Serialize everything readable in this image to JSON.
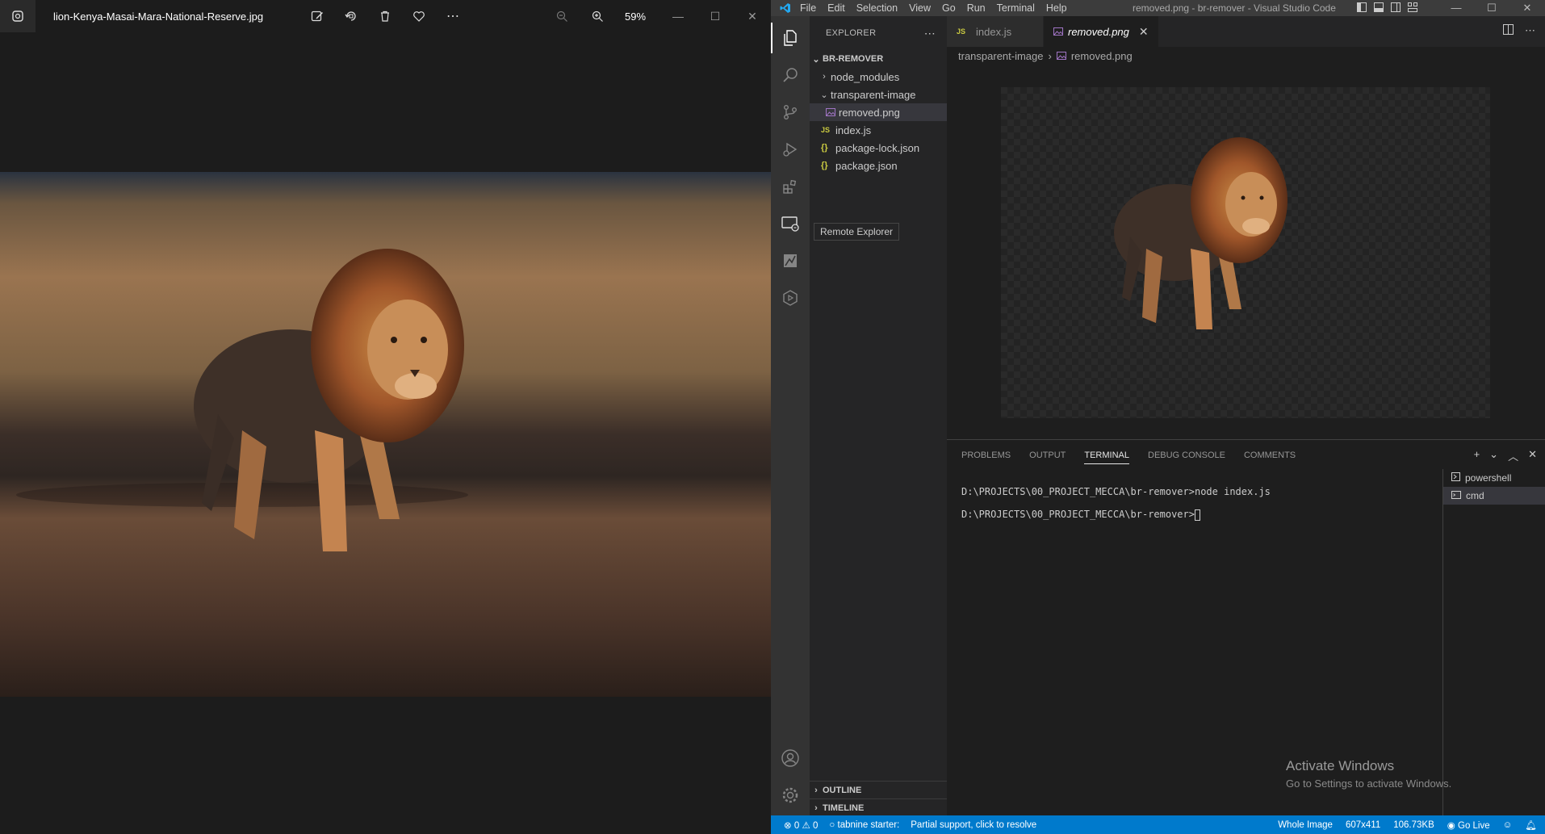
{
  "photos": {
    "filename": "lion-Kenya-Masai-Mara-National-Reserve.jpg",
    "zoom": "59%",
    "toolbar": [
      "edit-icon",
      "rotate-icon",
      "delete-icon",
      "favorite-icon",
      "more-icon"
    ]
  },
  "vscode": {
    "menu": [
      "File",
      "Edit",
      "Selection",
      "View",
      "Go",
      "Run",
      "Terminal",
      "Help"
    ],
    "window_title": "removed.png - br-remover - Visual Studio Code",
    "explorer": {
      "header": "EXPLORER",
      "project": "BR-REMOVER",
      "items": {
        "node_modules": "node_modules",
        "transparent_image": "transparent-image",
        "removed_png": "removed.png",
        "index_js": "index.js",
        "package_lock": "package-lock.json",
        "package_json": "package.json"
      },
      "outline": "OUTLINE",
      "timeline": "TIMELINE"
    },
    "tooltip": "Remote Explorer",
    "tabs": {
      "index_js": "index.js",
      "removed_png": "removed.png"
    },
    "breadcrumb": {
      "folder": "transparent-image",
      "file": "removed.png"
    },
    "panel": {
      "tabs": [
        "PROBLEMS",
        "OUTPUT",
        "TERMINAL",
        "DEBUG CONSOLE",
        "COMMENTS"
      ],
      "active_tab": "TERMINAL",
      "terminal_lines": {
        "line1": "D:\\PROJECTS\\00_PROJECT_MECCA\\br-remover>node index.js",
        "line2": "D:\\PROJECTS\\00_PROJECT_MECCA\\br-remover>"
      },
      "terminals": {
        "powershell": "powershell",
        "cmd": "cmd"
      },
      "activate_title": "Activate Windows",
      "activate_sub": "Go to Settings to activate Windows."
    },
    "statusbar": {
      "errors": "0",
      "warnings": "0",
      "tabnine": "tabnine starter:",
      "partial": "Partial support, click to resolve",
      "whole_image": "Whole Image",
      "dimensions": "607x411",
      "size": "106.73KB",
      "go_live": "Go Live"
    }
  },
  "colors": {
    "accent": "#007acc",
    "activity_bar": "#333333",
    "sidebar": "#252526",
    "editor": "#1e1e1e"
  }
}
